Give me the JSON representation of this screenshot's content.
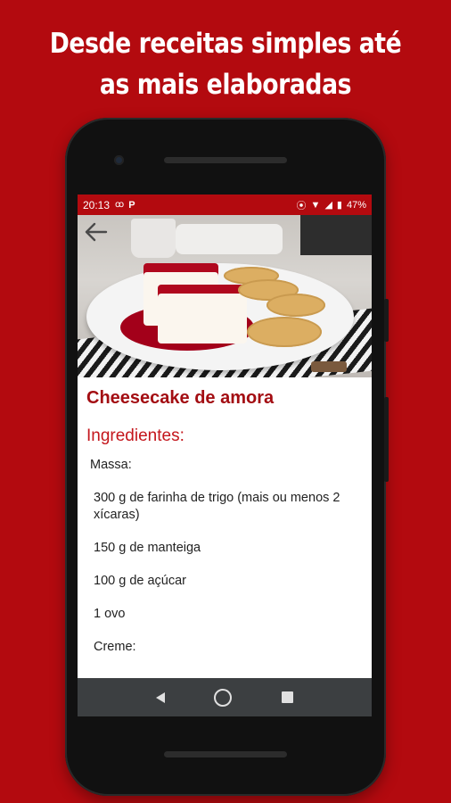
{
  "promo": {
    "line1": "Desde receitas simples até",
    "line2": "as mais elaboradas"
  },
  "statusbar": {
    "time": "20:13",
    "left_icons": [
      "voicemail-icon",
      "parking-icon"
    ],
    "battery": "47%",
    "right_icons": [
      "vibrate-icon",
      "wifi-icon",
      "signal-icon",
      "battery-icon"
    ]
  },
  "recipe": {
    "title": "Cheesecake de amora",
    "section_title": "Ingredientes:",
    "ingredients": [
      "Massa:",
      "300 g de farinha de trigo (mais ou menos 2 xícaras)",
      "150 g de manteiga",
      "100 g de açúcar",
      "1 ovo",
      "Creme:"
    ]
  },
  "colors": {
    "brand_red": "#b30a0f",
    "title_red": "#a30d12",
    "section_red": "#c4161c",
    "navbar": "#3c3f41"
  }
}
